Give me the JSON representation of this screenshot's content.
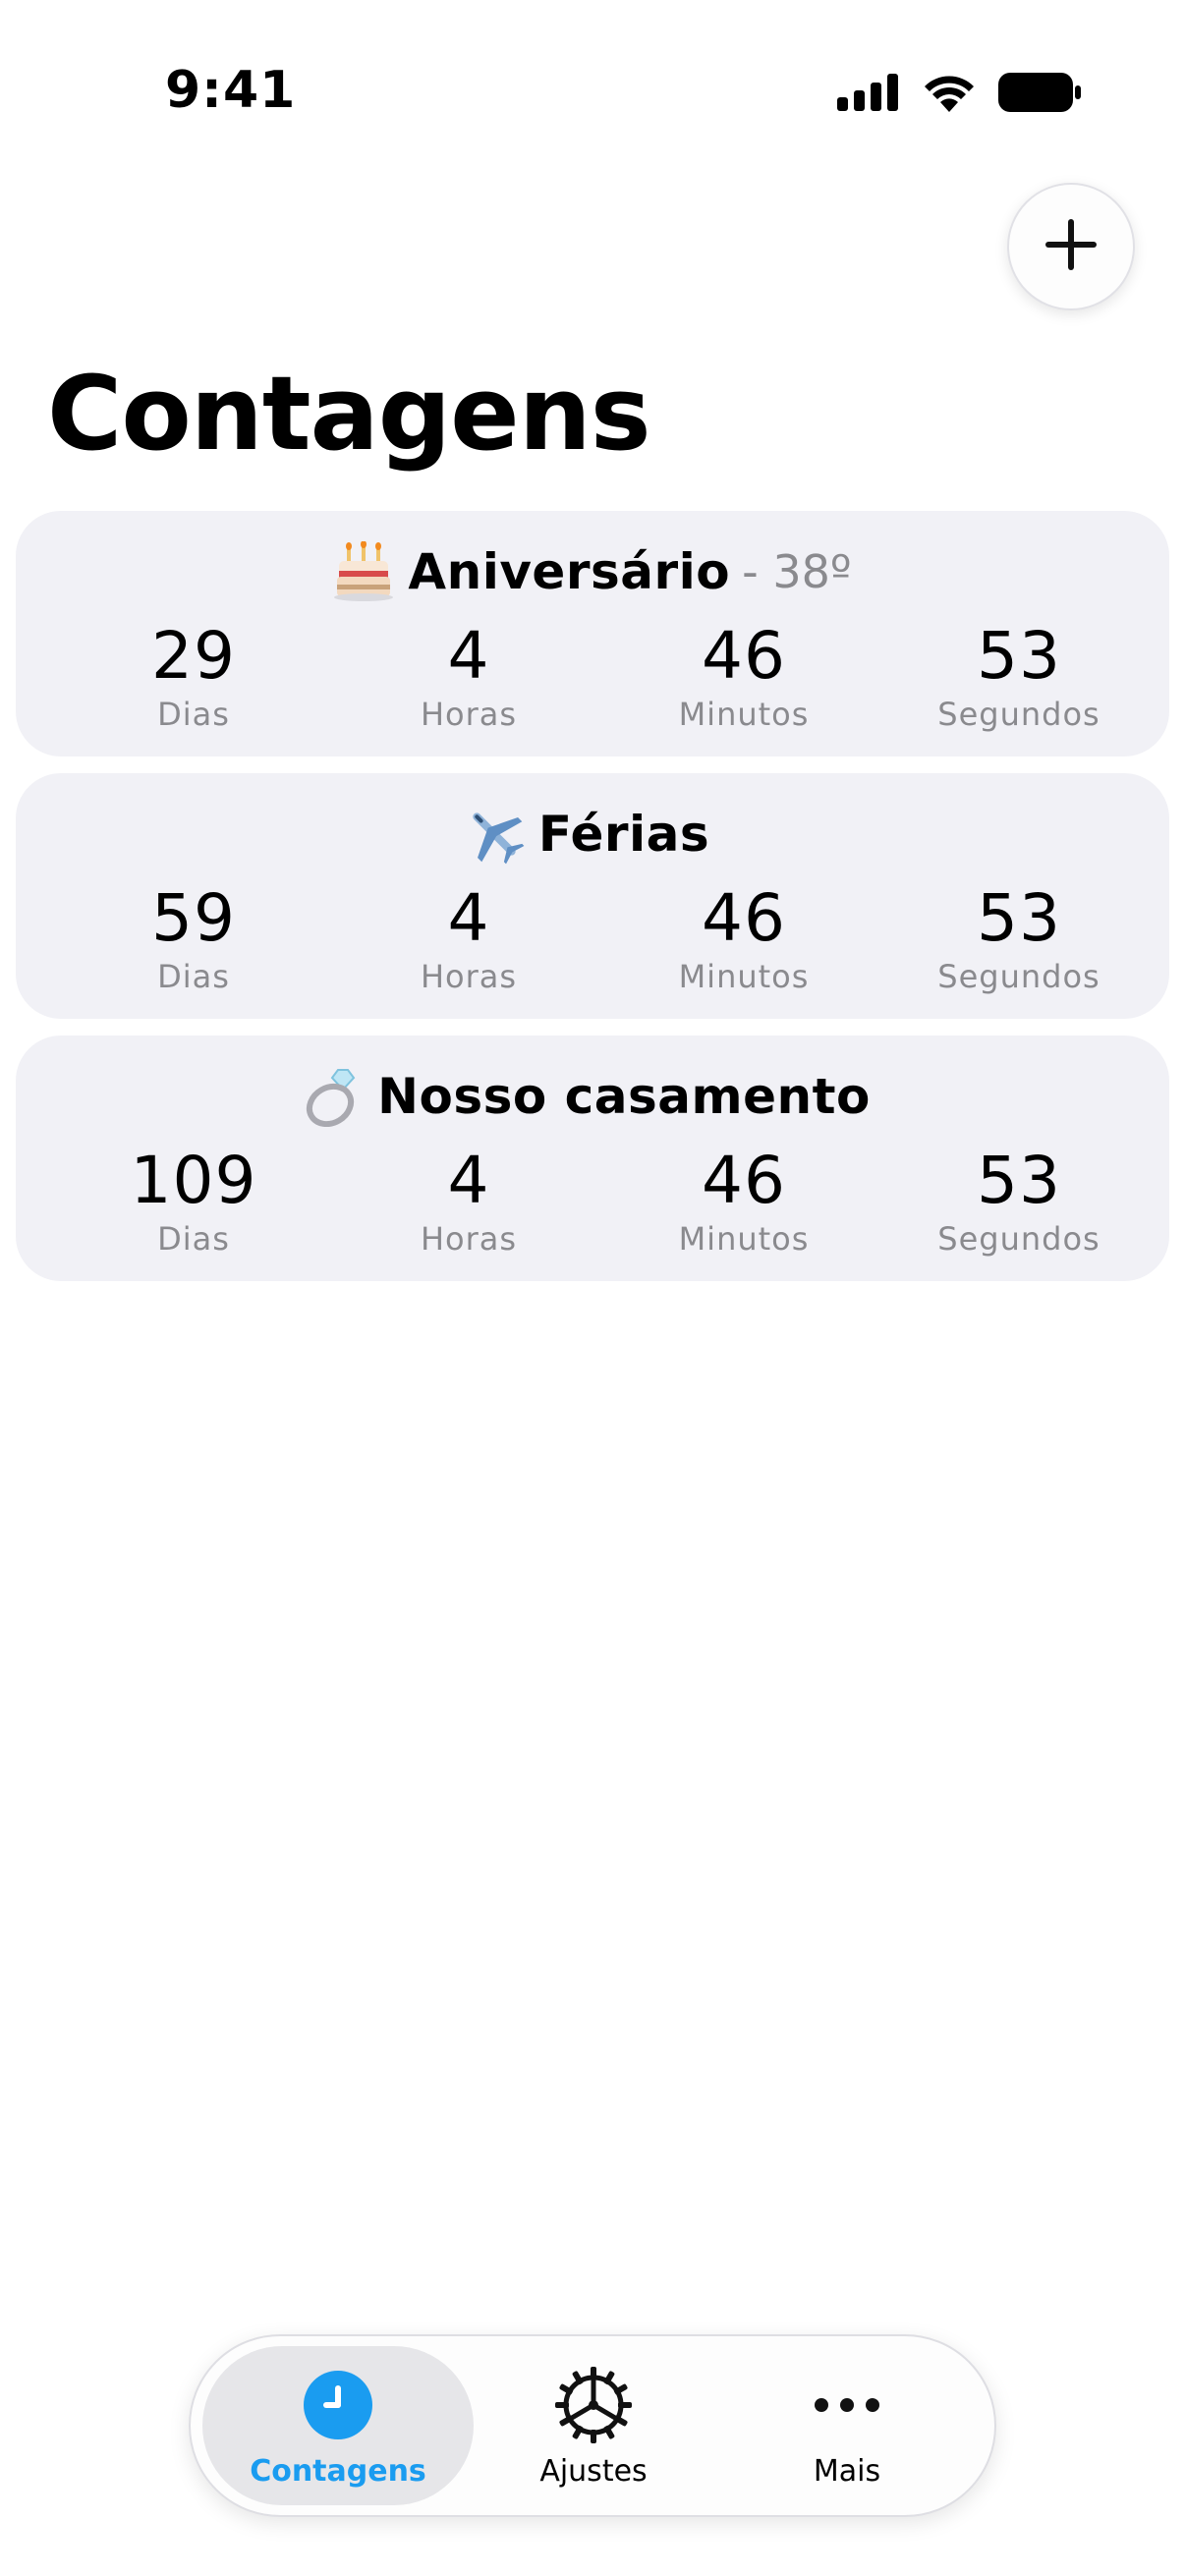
{
  "status_bar": {
    "time": "9:41"
  },
  "header": {
    "title": "Contagens",
    "add_icon": "plus-icon"
  },
  "countdowns": [
    {
      "emoji": "birthday-cake-icon",
      "title": "Aniversário",
      "suffix": "- 38º",
      "units": [
        {
          "value": "29",
          "label": "Dias"
        },
        {
          "value": "4",
          "label": "Horas"
        },
        {
          "value": "46",
          "label": "Minutos"
        },
        {
          "value": "53",
          "label": "Segundos"
        }
      ]
    },
    {
      "emoji": "airplane-icon",
      "title": "Férias",
      "suffix": "",
      "units": [
        {
          "value": "59",
          "label": "Dias"
        },
        {
          "value": "4",
          "label": "Horas"
        },
        {
          "value": "46",
          "label": "Minutos"
        },
        {
          "value": "53",
          "label": "Segundos"
        }
      ]
    },
    {
      "emoji": "ring-icon",
      "title": "Nosso casamento",
      "suffix": "",
      "units": [
        {
          "value": "109",
          "label": "Dias"
        },
        {
          "value": "4",
          "label": "Horas"
        },
        {
          "value": "46",
          "label": "Minutos"
        },
        {
          "value": "53",
          "label": "Segundos"
        }
      ]
    }
  ],
  "tab_bar": {
    "tabs": [
      {
        "label": "Contagens",
        "icon": "clock-icon",
        "active": true
      },
      {
        "label": "Ajustes",
        "icon": "gear-icon",
        "active": false
      },
      {
        "label": "Mais",
        "icon": "more-icon",
        "active": false
      }
    ]
  },
  "colors": {
    "accent": "#1a9cf0",
    "card_background": "#f1f1f6",
    "secondary_text": "#8a8a8e"
  }
}
